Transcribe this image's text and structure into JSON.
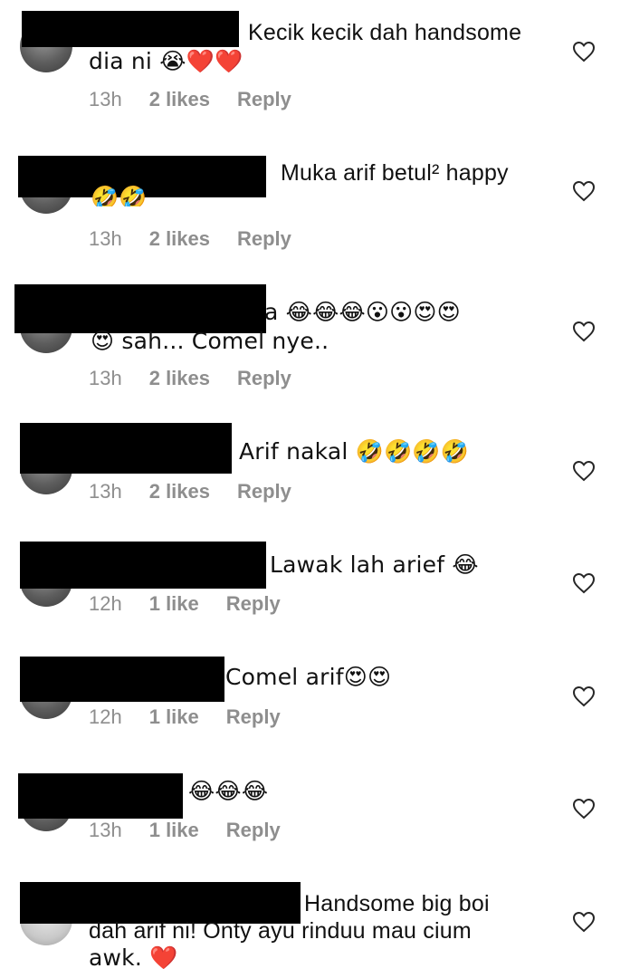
{
  "comments": [
    {
      "text_line1": "Kecik kecik dah handsome",
      "text_line2": "dia ni 😭❤️❤️",
      "time": "13h",
      "likes": "2 likes",
      "reply": "Reply"
    },
    {
      "text_line1": "Muka arif betul² happy",
      "text_line2": "🤣🤣",
      "time": "13h",
      "likes": "2 likes",
      "reply": "Reply"
    },
    {
      "text_line1": "a 😂😂😂😮😮😍😍",
      "text_line2": "😍 sah... Comel nye..",
      "time": "13h",
      "likes": "2 likes",
      "reply": "Reply"
    },
    {
      "text_line1": "Arif nakal 🤣🤣🤣🤣",
      "time": "13h",
      "likes": "2 likes",
      "reply": "Reply"
    },
    {
      "text_line1": "Lawak lah arief 😂",
      "time": "12h",
      "likes": "1 like",
      "reply": "Reply"
    },
    {
      "text_line1": "Comel arif😍😍",
      "time": "12h",
      "likes": "1 like",
      "reply": "Reply"
    },
    {
      "text_line1": "😂😂😂",
      "time": "13h",
      "likes": "1 like",
      "reply": "Reply"
    },
    {
      "text_line1": "Handsome big boi",
      "text_line2": "dah arif ni! Onty ayu rinduu mau cium",
      "text_line3": "awk. ❤️"
    }
  ],
  "icons": {
    "like": "heart-outline-icon"
  },
  "colors": {
    "meta": "#8e8e8e",
    "redaction": "#000000",
    "text": "#111111"
  }
}
